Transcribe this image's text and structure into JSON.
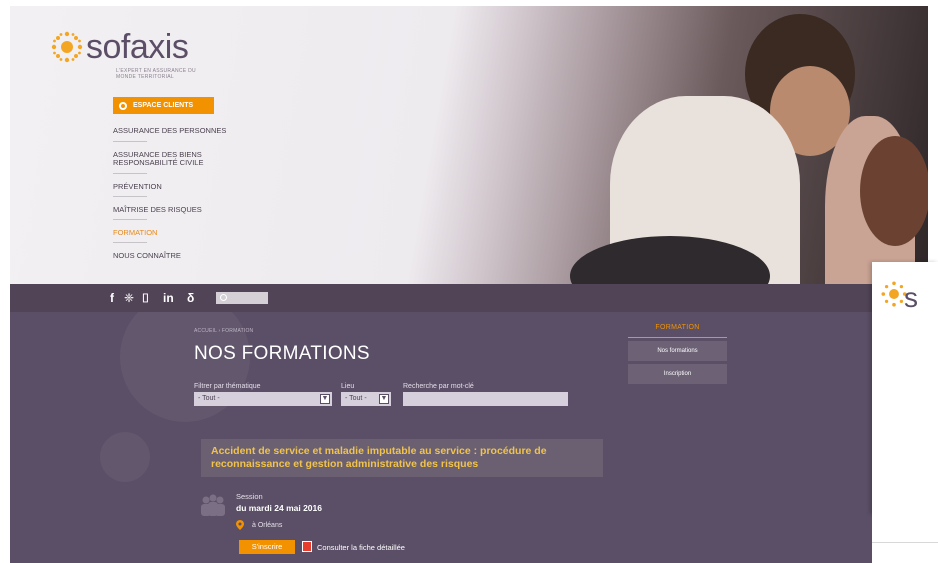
{
  "brand": {
    "name": "sofaxis",
    "tagline": "L'EXPERT EN ASSURANCE DU MONDE TERRITORIAL",
    "color": "#5b4e66",
    "accent": "#f39200"
  },
  "header": {
    "espace_clients_label": "ESPACE CLIENTS",
    "nav": [
      {
        "label": "ASSURANCE DES PERSONNES",
        "active": false
      },
      {
        "label": "ASSURANCE DES BIENS\nRESPONSABILITÉ CIVILE",
        "active": false
      },
      {
        "label": "PRÉVENTION",
        "active": false
      },
      {
        "label": "MAÎTRISE DES RISQUES",
        "active": false
      },
      {
        "label": "FORMATION",
        "active": true
      },
      {
        "label": "NOUS CONNAÎTRE",
        "active": false
      }
    ]
  },
  "toolbar": {
    "social": [
      {
        "icon": "facebook-icon",
        "label": "f"
      },
      {
        "icon": "twitter-icon",
        "label": "❈"
      },
      {
        "icon": "youtube-icon",
        "label": "⌷"
      },
      {
        "icon": "linkedin-icon",
        "label": "in"
      },
      {
        "icon": "viadeo-icon",
        "label": "δ"
      }
    ],
    "search_placeholder": ""
  },
  "breadcrumb": "ACCUEIL › FORMATION",
  "page_title": "NOS FORMATIONS",
  "filters": {
    "thematique_label": "Filtrer par thématique",
    "thematique_value": "- Tout -",
    "lieu_label": "Lieu",
    "lieu_value": "- Tout -",
    "keyword_label": "Recherche par mot-clé",
    "keyword_value": ""
  },
  "formation": {
    "title": "Accident de service et maladie imputable au service : procédure de reconnaissance et gestion administrative des risques",
    "session_label": "Session",
    "session_date": "du mardi 24 mai 2016",
    "location": "à Orléans",
    "register_label": "S'inscrire",
    "fiche_label": "Consulter la fiche détaillée"
  },
  "sidebar": {
    "title": "FORMATION",
    "items": [
      {
        "label": "Nos formations"
      },
      {
        "label": "Inscription"
      }
    ]
  }
}
